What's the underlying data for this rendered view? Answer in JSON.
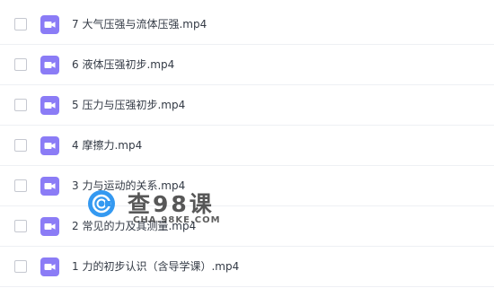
{
  "files": [
    {
      "name": "7 大气压强与流体压强.mp4",
      "icon": "video-file-icon"
    },
    {
      "name": "6 液体压强初步.mp4",
      "icon": "video-file-icon"
    },
    {
      "name": "5 压力与压强初步.mp4",
      "icon": "video-file-icon"
    },
    {
      "name": "4 摩擦力.mp4",
      "icon": "video-file-icon"
    },
    {
      "name": "3 力与运动的关系.mp4",
      "icon": "video-file-icon"
    },
    {
      "name": "2 常见的力及其测量.mp4",
      "icon": "video-file-icon"
    },
    {
      "name": "1 力的初步认识（含导学课）.mp4",
      "icon": "video-file-icon"
    }
  ],
  "watermark": {
    "title": "查98课",
    "subtitle": "CHA.98KE.COM"
  },
  "colors": {
    "icon_bg": "#8b7cf6",
    "icon_fg": "#ffffff",
    "text": "#333a45",
    "divider": "#eef0f4",
    "watermark_logo": "#1f8ff0"
  }
}
